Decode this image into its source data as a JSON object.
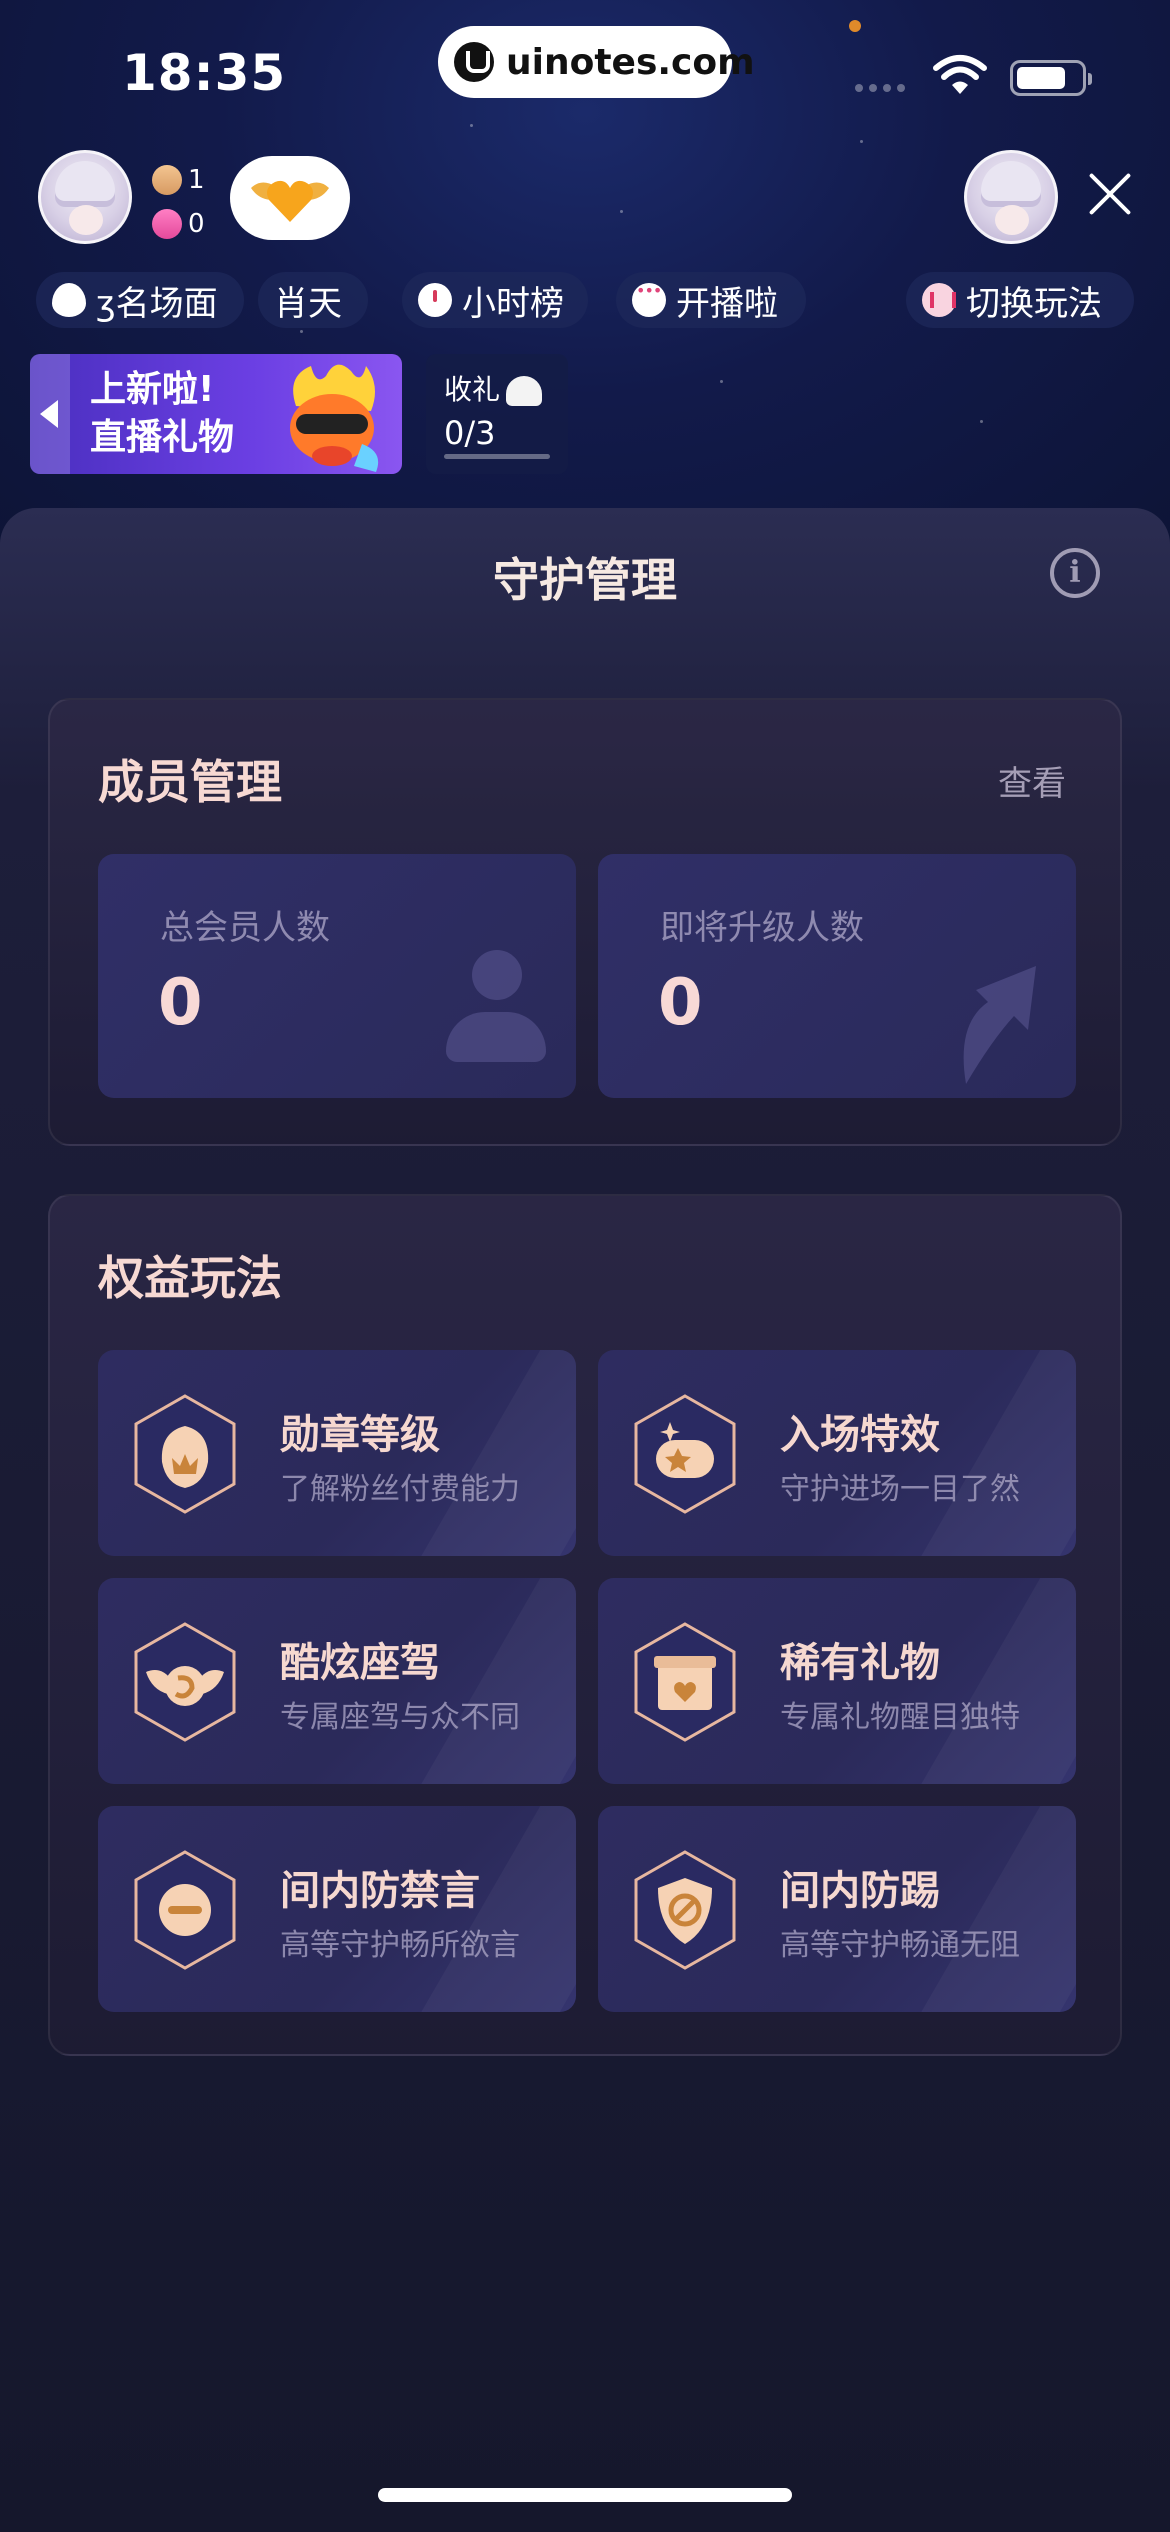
{
  "status_bar": {
    "time": "18:35",
    "url": "uinotes.com"
  },
  "live_header": {
    "viewer_count": "1",
    "like_count": "0",
    "pills": [
      {
        "label": "热名场面",
        "icon": "flame-icon"
      },
      {
        "label": "肖天",
        "icon": "none"
      },
      {
        "label": "小时榜",
        "icon": "clock-icon"
      },
      {
        "label": "开播啦",
        "icon": "chat-icon"
      },
      {
        "label": "切换玩法",
        "icon": "switch-icon"
      }
    ],
    "pills_display": [
      "ʒ名场面",
      "肖天"
    ],
    "banner": {
      "line1": "上新啦!",
      "line2": "直播礼物"
    },
    "gift_task": {
      "label": "收礼",
      "progress": "0/3"
    }
  },
  "sheet": {
    "title": "守护管理",
    "members": {
      "title": "成员管理",
      "view_link": "查看",
      "stats": [
        {
          "label": "总会员人数",
          "value": "0"
        },
        {
          "label": "即将升级人数",
          "value": "0"
        }
      ]
    },
    "benefits": {
      "title": "权益玩法",
      "items": [
        {
          "title": "勋章等级",
          "desc": "了解粉丝付费能力",
          "icon": "medal-icon"
        },
        {
          "title": "入场特效",
          "desc": "守护进场一目了然",
          "icon": "entrance-effect-icon"
        },
        {
          "title": "酷炫座驾",
          "desc": "专属座驾与众不同",
          "icon": "wing-badge-icon"
        },
        {
          "title": "稀有礼物",
          "desc": "专属礼物醒目独特",
          "icon": "gift-box-icon"
        },
        {
          "title": "间内防禁言",
          "desc": "高等守护畅所欲言",
          "icon": "anti-mute-icon"
        },
        {
          "title": "间内防踢",
          "desc": "高等守护畅通无阻",
          "icon": "anti-kick-icon"
        }
      ]
    }
  },
  "colors": {
    "background": "#0f1226",
    "sheet": "#1d1e3a",
    "card": "#2e2c60",
    "title_text": "#f6d8d0",
    "muted_text": "#8d88ad"
  }
}
